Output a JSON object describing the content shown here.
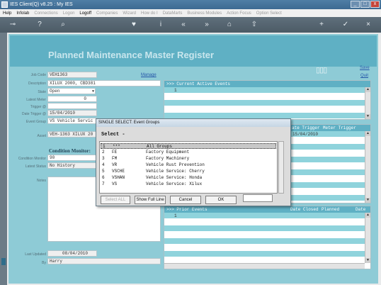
{
  "window": {
    "title": "IES Client(Q) v8.25 : My IES"
  },
  "menu": [
    {
      "label": "Help",
      "enabled": true
    },
    {
      "label": "Infolab",
      "enabled": true
    },
    {
      "label": "Connections",
      "enabled": false
    },
    {
      "label": "Logon",
      "enabled": false
    },
    {
      "label": "Logoff",
      "enabled": true
    },
    {
      "label": "Companies",
      "enabled": false
    },
    {
      "label": "Wizard",
      "enabled": false
    },
    {
      "label": "How do I",
      "enabled": false
    },
    {
      "label": "DataMarts",
      "enabled": false
    },
    {
      "label": "Business Modules",
      "enabled": false
    },
    {
      "label": "Action Focus",
      "enabled": false
    },
    {
      "label": "Option Select",
      "enabled": false
    }
  ],
  "page": {
    "title": "Planned Maintenance Master Register",
    "save_link": "Save",
    "quit_link": "Quit",
    "manage_link": "Manage"
  },
  "form": {
    "job_code_label": "Job Code",
    "job_code": "VEH1363",
    "description_label": "Description",
    "description": "XILUX 2000, CBD381",
    "state_label": "State",
    "state": "Open",
    "latest_meter_label": "Latest Meter",
    "latest_meter": "0",
    "trigger_label": "Trigger @",
    "date_trigger_label": "Date Trigger @",
    "date_trigger": "15/04/2010",
    "event_group_label": "Event Group",
    "event_group": "VS Vehicle Servic",
    "asset_label": "Asset",
    "asset": "VEH-1363 XILUX 20",
    "condition_monitor_title": "Condition Monitor:",
    "condition_monitor_label": "Condition Monitor",
    "condition_monitor": "90",
    "latest_status_label": "Latest Status",
    "latest_status": "No History",
    "notes_label": "Notes",
    "last_updated_label": "Last Updated",
    "last_updated": "08/04/2010",
    "by_label": "By",
    "by": "Harry"
  },
  "current_events": {
    "header": ">>> Current Active Events",
    "first_row_marker": "1"
  },
  "trigger_panel": {
    "col_date_trigger": "ate Trigger",
    "col_meter_trigger": "Meter Trigger",
    "first_date": "15/04/2010"
  },
  "prior_events": {
    "header": ">>> Prior Events",
    "col_date_closed": "Date Closed",
    "col_planned": "Planned",
    "col_date": "Date",
    "first_row_marker": "1"
  },
  "dialog": {
    "title": "SINGLE SELECT: Event Groups",
    "select_label": "Select -",
    "items": [
      {
        "num": "1",
        "code": "***",
        "desc": "All Groups",
        "selected": true
      },
      {
        "num": "2",
        "code": "FE",
        "desc": "Factory Equipment",
        "selected": false
      },
      {
        "num": "3",
        "code": "FM",
        "desc": "Factory Machinery",
        "selected": false
      },
      {
        "num": "4",
        "code": "VR",
        "desc": "Vehicle Rust Prevention",
        "selected": false
      },
      {
        "num": "5",
        "code": "VSCHE",
        "desc": "Vehicle Service: Cherry",
        "selected": false
      },
      {
        "num": "6",
        "code": "VSHAN",
        "desc": "Vehicle Service: Honda",
        "selected": false
      },
      {
        "num": "7",
        "code": "VS",
        "desc": "Vehicle Service: Xilux",
        "selected": false
      }
    ],
    "btn_select_all": "Select ALL",
    "btn_show_full_line": "Show Full Line",
    "btn_cancel": "Cancel",
    "btn_ok": "OK"
  }
}
